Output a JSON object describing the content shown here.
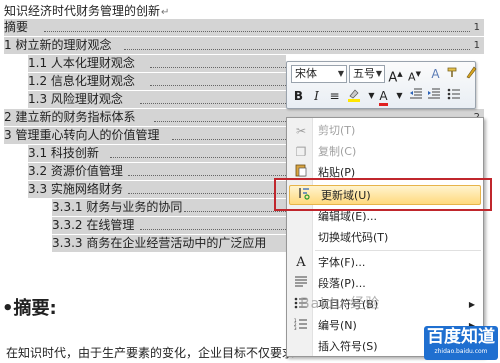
{
  "document": {
    "title": "知识经济时代财务管理的创新",
    "para_mark": "↵",
    "toc": [
      {
        "text": "摘要",
        "page": "1"
      },
      {
        "text": "1 树立新的理财观念",
        "page": "1"
      },
      {
        "text": "1.1 人本化理财观念",
        "page": ""
      },
      {
        "text": "1.2 信息化理财观念",
        "page": ""
      },
      {
        "text": "1.3 风险理财观念",
        "page": ""
      },
      {
        "text": "2 建立新的财务指标体系",
        "page": "2"
      },
      {
        "text": "3 管理重心转向人的价值管理",
        "page": ""
      },
      {
        "text": "3.1 科技创新",
        "page": ""
      },
      {
        "text": "3.2 资源价值管理",
        "page": ""
      },
      {
        "text": "3.3 实施网络财务",
        "page": ""
      },
      {
        "text": "3.3.1 财务与业务的协同",
        "page": ""
      },
      {
        "text": "3.3.2 在线管理",
        "page": ""
      },
      {
        "text": "3.3.3 商务在企业经营活动中的广泛应用",
        "page": ""
      }
    ],
    "heading": "•摘要:",
    "body_text": "在知识时代，由于生产要素的变化，企业目标不仅要求..."
  },
  "mini_toolbar": {
    "font_name": "宋体",
    "font_size": "五号",
    "grow_font": "A",
    "shrink_font": "A",
    "style_a": "A",
    "bold": "B",
    "italic": "I",
    "center": "≡",
    "font_color": "A"
  },
  "context_menu": {
    "items": [
      {
        "label": "剪切(T)",
        "icon": "scissors-icon",
        "disabled": true
      },
      {
        "label": "复制(C)",
        "icon": "copy-icon",
        "disabled": true
      },
      {
        "label": "粘贴(P)",
        "icon": "paste-icon",
        "disabled": false
      },
      {
        "label": "更新域(U)",
        "icon": "update-field-icon",
        "disabled": false
      },
      {
        "label": "编辑域(E)...",
        "icon": "",
        "disabled": false
      },
      {
        "label": "切换域代码(T)",
        "icon": "",
        "disabled": false
      },
      {
        "label": "字体(F)...",
        "icon": "font-icon",
        "disabled": false
      },
      {
        "label": "段落(P)...",
        "icon": "paragraph-icon",
        "disabled": false
      },
      {
        "label": "项目符号(B)",
        "icon": "bullets-icon",
        "disabled": false
      },
      {
        "label": "编号(N)",
        "icon": "numbering-icon",
        "disabled": false
      },
      {
        "label": "插入符号(S)",
        "icon": "",
        "disabled": false
      }
    ]
  },
  "watermark": {
    "mid": "Baidu 经验",
    "logo": "百度知道",
    "logo_sub": "zhidao.baidu.com"
  },
  "colors": {
    "selection": "#d4d4d4",
    "highlight_box": "#c0262c",
    "hover_item": "#ffd97e"
  }
}
